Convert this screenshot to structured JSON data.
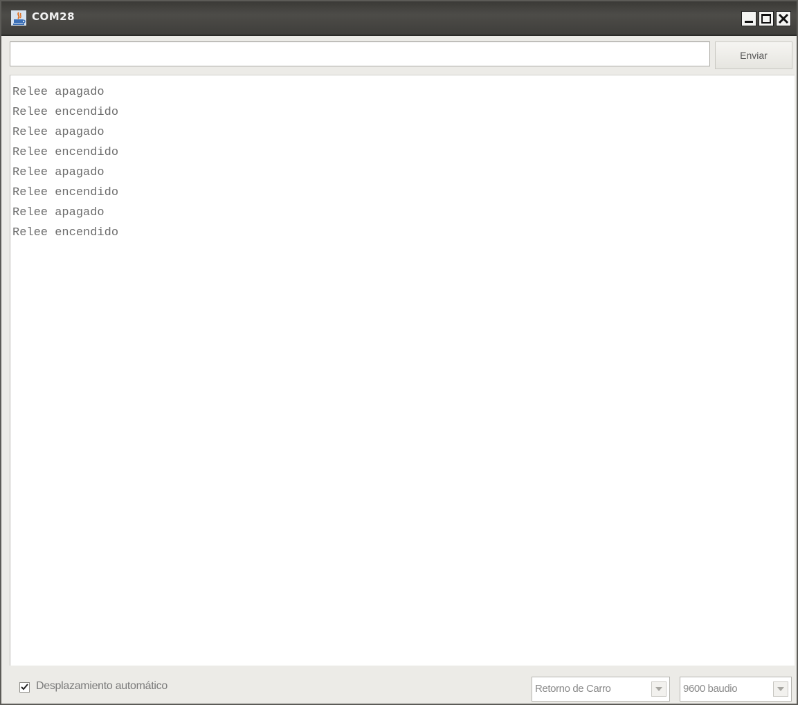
{
  "window": {
    "title": "COM28",
    "icon": "java-app-icon",
    "controls": [
      "minimize-icon",
      "maximize-icon",
      "close-icon"
    ]
  },
  "input": {
    "value": "",
    "send_label": "Enviar"
  },
  "output": {
    "lines": [
      "Relee apagado",
      "Relee encendido",
      "Relee apagado",
      "Relee encendido",
      "Relee apagado",
      "Relee encendido",
      "Relee apagado",
      "Relee encendido"
    ]
  },
  "statusbar": {
    "autoscroll_label": "Desplazamiento automático",
    "autoscroll_checked": true,
    "line_ending": "Retorno de Carro",
    "baud_rate": "9600 baudio"
  },
  "colors": {
    "titlebar": "#45443f",
    "window_bg": "#ecebe7",
    "output_text": "#6c6c6c"
  }
}
